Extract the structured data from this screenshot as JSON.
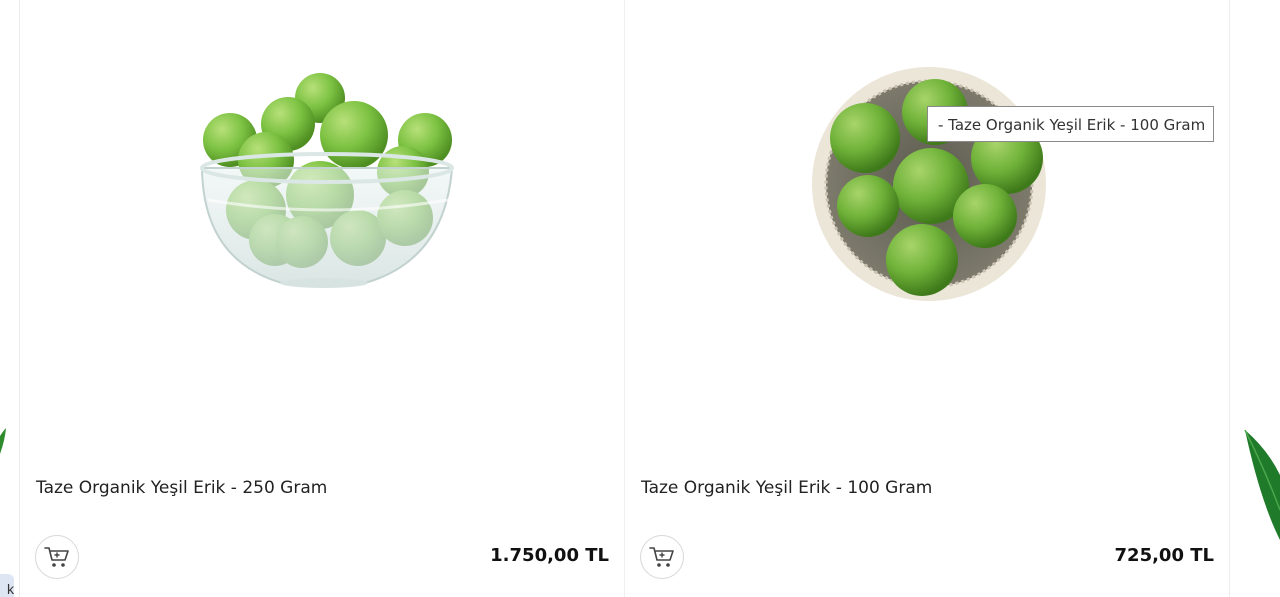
{
  "products": [
    {
      "title": "Taze Organik Yeşil Erik - 250 Gram",
      "price": "1.750,00 TL",
      "image": "green-plums-in-glass-bowl",
      "cart_icon": "cart-icon"
    },
    {
      "title": "Taze Organik Yeşil Erik - 100 Gram",
      "price": "725,00 TL",
      "image": "green-plums-in-ceramic-bowl",
      "cart_icon": "cart-icon"
    }
  ],
  "tooltip": {
    "text": "- Taze Organik Yeşil Erik - 100 Gram"
  },
  "left_edge_chip": {
    "text": "k"
  },
  "colors": {
    "plum_green": "#7cc242",
    "plum_dark": "#4f8f22",
    "leaf_green": "#2e8b2e",
    "price_text": "#111111",
    "card_border": "#efefef"
  }
}
